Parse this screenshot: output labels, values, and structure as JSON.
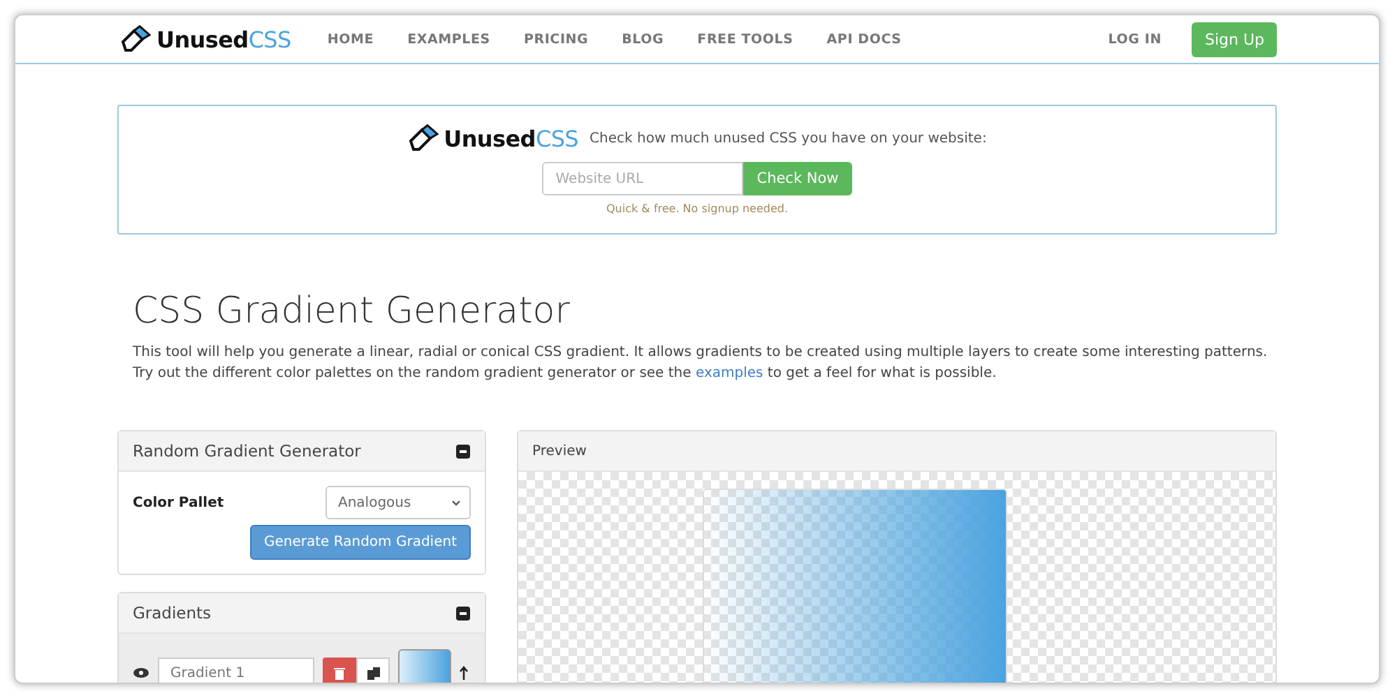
{
  "nav": {
    "logo": {
      "first": "Unused",
      "second": "CSS"
    },
    "links": [
      {
        "label": "HOME"
      },
      {
        "label": "EXAMPLES"
      },
      {
        "label": "PRICING"
      },
      {
        "label": "BLOG"
      },
      {
        "label": "FREE TOOLS"
      },
      {
        "label": "API DOCS"
      }
    ],
    "login": "LOG IN",
    "signup": "Sign Up"
  },
  "banner": {
    "logo": {
      "first": "Unused",
      "second": "CSS"
    },
    "tagline": "Check how much unused CSS you have on your website:",
    "url_field": {
      "placeholder": "Website URL"
    },
    "button": "Check Now",
    "note": "Quick & free. No signup needed."
  },
  "title": "CSS Gradient Generator",
  "intro": {
    "before": "This tool will help you generate a linear, radial or conical CSS gradient. It allows gradients to be created using multiple layers to create some interesting patterns. Try out the different color palettes on the random gradient generator or see the ",
    "link": "examples",
    "after": " to get a feel for what is possible."
  },
  "random_panel": {
    "title": "Random Gradient Generator",
    "label": "Color Pallet",
    "select": "Analogous",
    "button": "Generate Random Gradient"
  },
  "gradients_panel": {
    "title": "Gradients",
    "layers": [
      {
        "name": "Gradient 1"
      }
    ]
  },
  "preview_panel": {
    "title": "Preview"
  }
}
